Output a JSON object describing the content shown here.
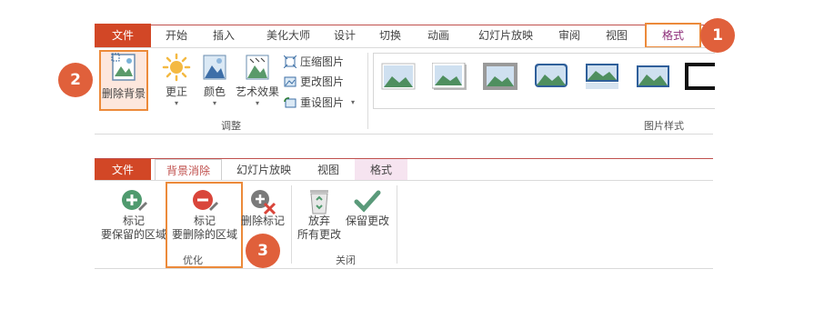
{
  "ribbon1": {
    "tabs": [
      {
        "label": "文件"
      },
      {
        "label": "开始"
      },
      {
        "label": "插入"
      },
      {
        "label": "美化大师"
      },
      {
        "label": "设计"
      },
      {
        "label": "切换"
      },
      {
        "label": "动画"
      },
      {
        "label": "幻灯片放映"
      },
      {
        "label": "审阅"
      },
      {
        "label": "视图"
      },
      {
        "label": "格式"
      }
    ],
    "adjust": {
      "remove_bg": "删除背景",
      "correct": "更正",
      "color": "颜色",
      "artistic": "艺术效果",
      "compress": "压缩图片",
      "change": "更改图片",
      "reset": "重设图片",
      "group_label": "调整"
    },
    "styles_group_label": "图片样式"
  },
  "ribbon2": {
    "tabs": [
      {
        "label": "文件"
      },
      {
        "label": "背景消除"
      },
      {
        "label": "幻灯片放映"
      },
      {
        "label": "视图"
      },
      {
        "label": "格式"
      }
    ],
    "keep": {
      "line1": "标记",
      "line2": "要保留的区域"
    },
    "remove": {
      "line1": "标记",
      "line2": "要删除的区域"
    },
    "delete_mark": "删除标记",
    "refine_label": "优化",
    "discard": {
      "line1": "放弃",
      "line2": "所有更改"
    },
    "keep_changes": "保留更改",
    "close_label": "关闭"
  },
  "callouts": {
    "one": "1",
    "two": "2",
    "three": "3"
  },
  "colors": {
    "file_tab": "#d24726",
    "accent_orange": "#ec8a3a",
    "callout": "#e0603b",
    "format_tab_text": "#8e2e7a"
  }
}
